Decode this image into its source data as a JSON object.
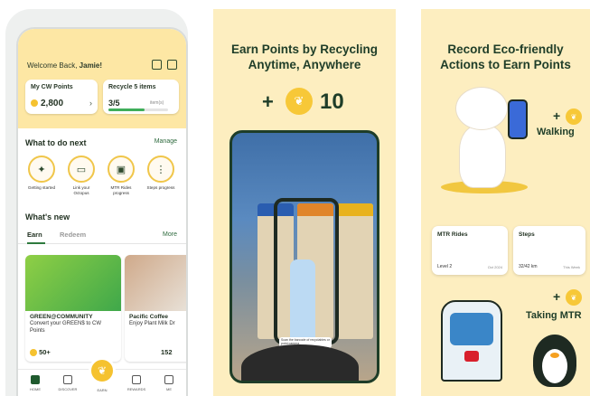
{
  "panel1": {
    "welcome_prefix": "Welcome Back,",
    "welcome_name": "Jamie!",
    "points_card": {
      "title": "My CW Points",
      "value": "2,800"
    },
    "recycle_card": {
      "title": "Recycle 5 items",
      "value": "3/5",
      "sub": "item(s)",
      "progress": 0.6
    },
    "what_to_do": {
      "title": "What to do next",
      "manage": "Manage"
    },
    "actions": [
      {
        "label": "Getting started"
      },
      {
        "label": "Link your Octopus"
      },
      {
        "label": "MTR Rides progress"
      },
      {
        "label": "Steps progress"
      }
    ],
    "whats_new": {
      "title": "What's new"
    },
    "tabs": {
      "earn": "Earn",
      "redeem": "Redeem",
      "more": "More"
    },
    "offers": [
      {
        "title": "GREEN@COMMUNITY",
        "subtitle": "Convert your GREEN$ to CW Points",
        "points": "50+"
      },
      {
        "title": "Pacific Coffee",
        "subtitle": "Enjoy Plant Milk Dr",
        "points": "152"
      }
    ],
    "nav": {
      "home": "HOME",
      "discover": "DISCOVER",
      "earn": "EARN",
      "rewards": "REWARDS",
      "me": "ME"
    }
  },
  "panel2": {
    "title_line1": "Earn Points by Recycling",
    "title_line2": "Anytime, Anywhere",
    "plus": "+",
    "points": "10",
    "toast": "Scan the barcode of recyclables or point camera"
  },
  "panel3": {
    "title_line1": "Record Eco-friendly",
    "title_line2": "Actions to Earn Points",
    "walking": "Walking",
    "taking_mtr": "Taking MTR",
    "plus": "+",
    "mtr_card": {
      "title": "MTR Rides",
      "level": "Level 2",
      "date": "Oct 2024"
    },
    "steps_card": {
      "title": "Steps",
      "value": "32/42 km",
      "period": "This Week"
    }
  },
  "colors": {
    "accent": "#f7c838",
    "brand": "#1e3d28",
    "bg": "#fdeec0"
  }
}
